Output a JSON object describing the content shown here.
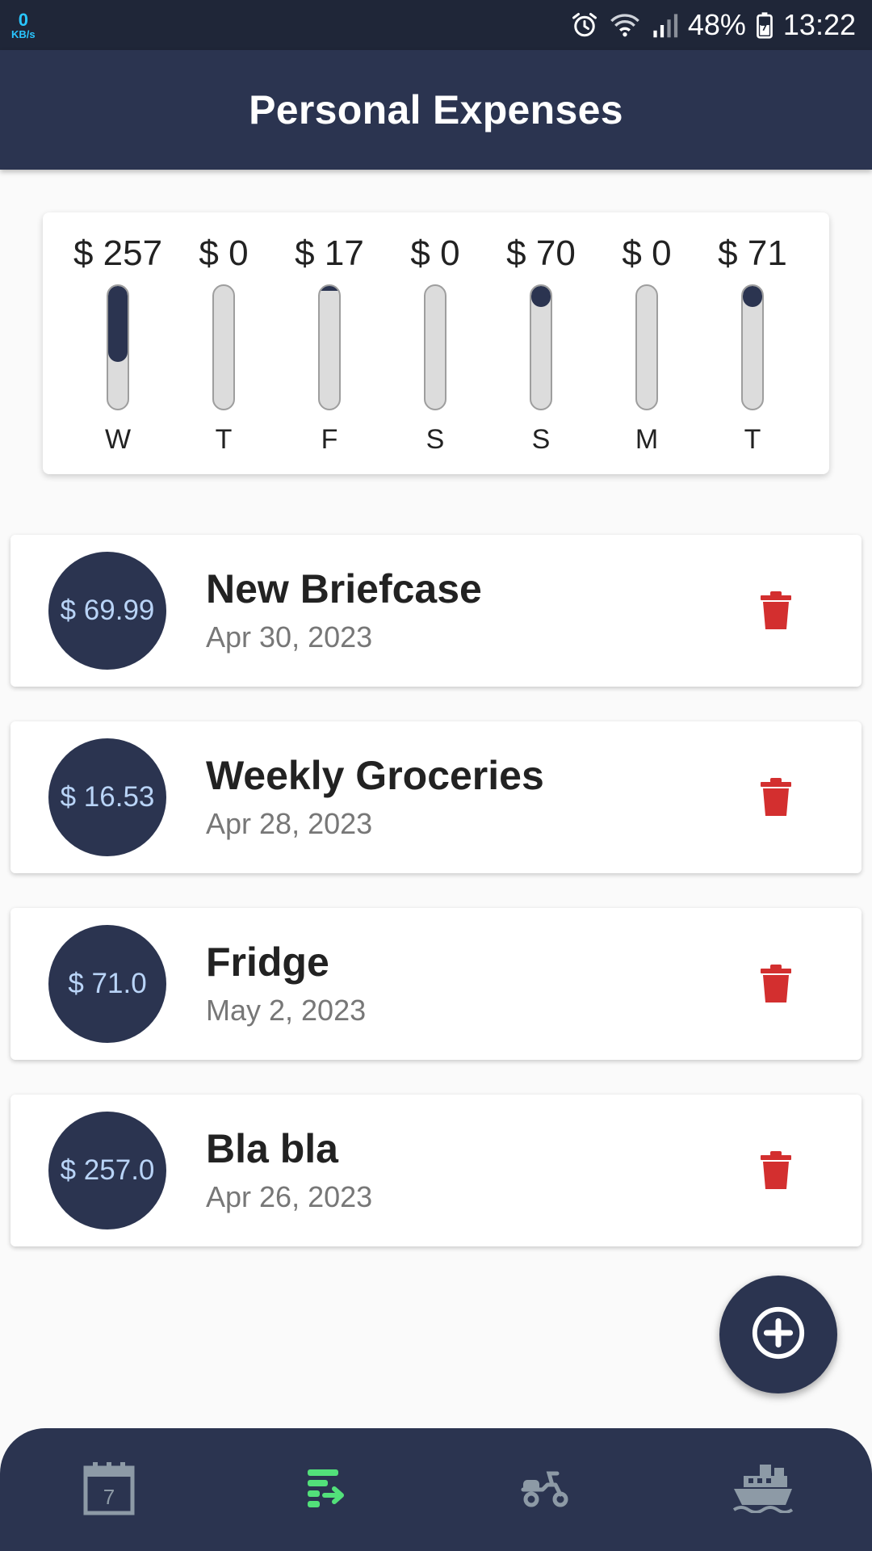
{
  "status_bar": {
    "net_speed_value": "0",
    "net_speed_unit": "KB/s",
    "battery": "48%",
    "time": "13:22",
    "icons": [
      "alarm-icon",
      "wifi-icon",
      "signal-icon",
      "battery-icon"
    ]
  },
  "app_bar": {
    "title": "Personal Expenses"
  },
  "colors": {
    "primary": "#2b3450",
    "status_bar": "#1f2638",
    "amount_text": "#b9d4f7",
    "delete": "#d32f2f",
    "nav_active": "#52e07a",
    "nav_inactive": "#8d9aa6"
  },
  "weekly_chart": {
    "bars": [
      {
        "amount": "$ 257",
        "day": "W",
        "fill": 0.62
      },
      {
        "amount": "$ 0",
        "day": "T",
        "fill": 0.0
      },
      {
        "amount": "$ 17",
        "day": "F",
        "fill": 0.04
      },
      {
        "amount": "$ 0",
        "day": "S",
        "fill": 0.0
      },
      {
        "amount": "$ 70",
        "day": "S",
        "fill": 0.17
      },
      {
        "amount": "$ 0",
        "day": "M",
        "fill": 0.0
      },
      {
        "amount": "$ 71",
        "day": "T",
        "fill": 0.17
      }
    ]
  },
  "expenses": [
    {
      "amount": "$ 69.99",
      "title": "New Briefcase",
      "date": "Apr 30, 2023",
      "delete_icon": "trash-icon"
    },
    {
      "amount": "$ 16.53",
      "title": "Weekly Groceries",
      "date": "Apr 28, 2023",
      "delete_icon": "trash-icon"
    },
    {
      "amount": "$ 71.0",
      "title": "Fridge",
      "date": "May 2, 2023",
      "delete_icon": "trash-icon"
    },
    {
      "amount": "$ 257.0",
      "title": "Bla bla",
      "date": "Apr 26, 2023",
      "delete_icon": "trash-icon"
    }
  ],
  "fab": {
    "icon": "add-circle-icon"
  },
  "bottom_nav": {
    "items": [
      {
        "icon": "calendar-icon",
        "calendar_day": "7",
        "active": false
      },
      {
        "icon": "expense-list-icon",
        "active": true
      },
      {
        "icon": "scooter-icon",
        "active": false
      },
      {
        "icon": "ship-icon",
        "active": false
      }
    ]
  }
}
